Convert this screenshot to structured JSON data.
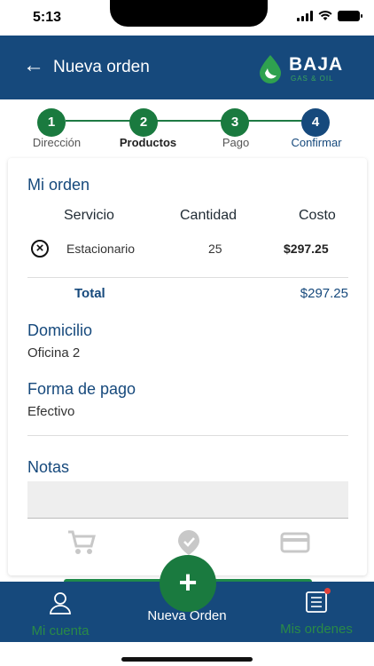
{
  "status_bar": {
    "time": "5:13"
  },
  "header": {
    "title": "Nueva orden",
    "logo_text": "BAJA",
    "logo_sub": "GAS & OIL"
  },
  "stepper": {
    "steps": [
      {
        "number": "1",
        "label": "Dirección",
        "state": "done"
      },
      {
        "number": "2",
        "label": "Productos",
        "state": "done"
      },
      {
        "number": "3",
        "label": "Pago",
        "state": "done"
      },
      {
        "number": "4",
        "label": "Confirmar",
        "state": "active"
      }
    ]
  },
  "order": {
    "title": "Mi orden",
    "columns": {
      "service": "Servicio",
      "quantity": "Cantidad",
      "cost": "Costo"
    },
    "items": [
      {
        "service": "Estacionario",
        "quantity": "25",
        "cost": "$297.25"
      }
    ],
    "total_label": "Total",
    "total_value": "$297.25"
  },
  "address": {
    "title": "Domicilio",
    "value": "Oficina 2"
  },
  "payment": {
    "title": "Forma de pago",
    "value": "Efectivo"
  },
  "notes": {
    "title": "Notas",
    "value": ""
  },
  "bottom_nav": {
    "account_label": "Mi cuenta",
    "new_order_label": "Nueva Orden",
    "orders_label": "Mis ordenes",
    "fab_symbol": "+"
  },
  "colors": {
    "primary": "#16497c",
    "accent_green": "#1a7a3f",
    "nav_label_green": "#2a8a47"
  }
}
